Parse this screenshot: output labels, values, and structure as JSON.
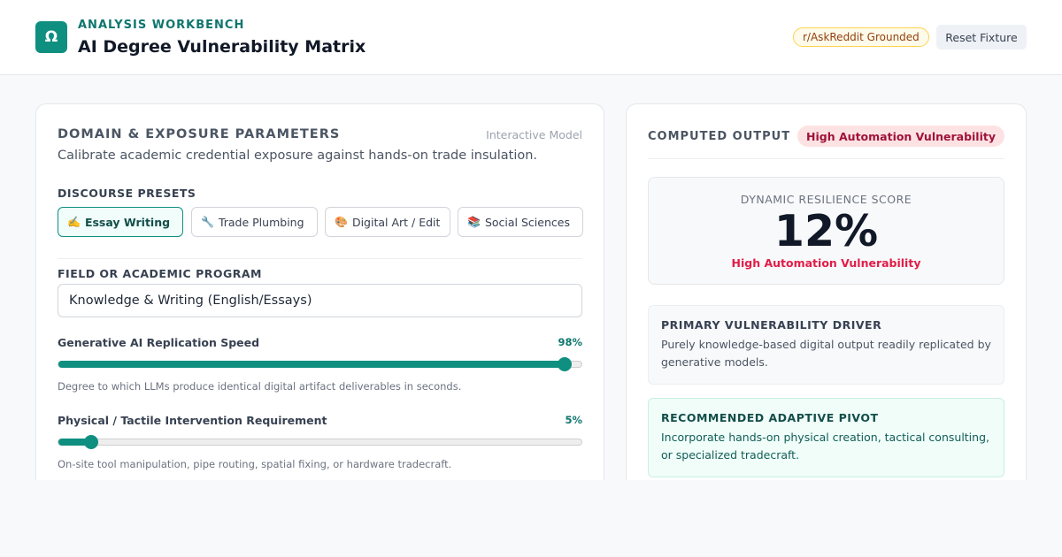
{
  "header": {
    "logo_glyph": "Ω",
    "eyebrow": "ANALYSIS WORKBENCH",
    "title": "AI Degree Vulnerability Matrix",
    "source_badge": "r/AskReddit Grounded",
    "reset_label": "Reset Fixture"
  },
  "params": {
    "title": "DOMAIN & EXPOSURE PARAMETERS",
    "tag": "Interactive Model",
    "subtitle": "Calibrate academic credential exposure against hands-on trade insulation.",
    "presets_label": "DISCOURSE PRESETS",
    "presets": [
      {
        "icon": "✍️",
        "label": "Essay Writing",
        "active": true
      },
      {
        "icon": "🔧",
        "label": "Trade Plumbing",
        "active": false
      },
      {
        "icon": "🎨",
        "label": "Digital Art / Edit",
        "active": false
      },
      {
        "icon": "📚",
        "label": "Social Sciences",
        "active": false
      }
    ],
    "field_label": "FIELD OR ACADEMIC PROGRAM",
    "field_value": "Knowledge & Writing (English/Essays)",
    "sliders": [
      {
        "label": "Generative AI Replication Speed",
        "value_text": "98%",
        "value": 98,
        "hint": "Degree to which LLMs produce identical digital artifact deliverables in seconds."
      },
      {
        "label": "Physical / Tactile Intervention Requirement",
        "value_text": "5%",
        "value": 5,
        "hint": "On-site tool manipulation, pipe routing, spatial fixing, or hardware tradecraft."
      }
    ]
  },
  "output": {
    "title": "COMPUTED OUTPUT",
    "badge": "High Automation Vulnerability",
    "score_label": "DYNAMIC RESILIENCE SCORE",
    "score_value": "12%",
    "score_note": "High Automation Vulnerability",
    "driver_head": "PRIMARY VULNERABILITY DRIVER",
    "driver_body": "Purely knowledge-based digital output readily replicated by generative models.",
    "pivot_head": "RECOMMENDED ADAPTIVE PIVOT",
    "pivot_body": "Incorporate hands-on physical creation, tactical consulting, or specialized tradecraft."
  },
  "colors": {
    "accent": "#0f8f80",
    "danger": "#e11d48",
    "warning_bg": "#fffbeb"
  }
}
